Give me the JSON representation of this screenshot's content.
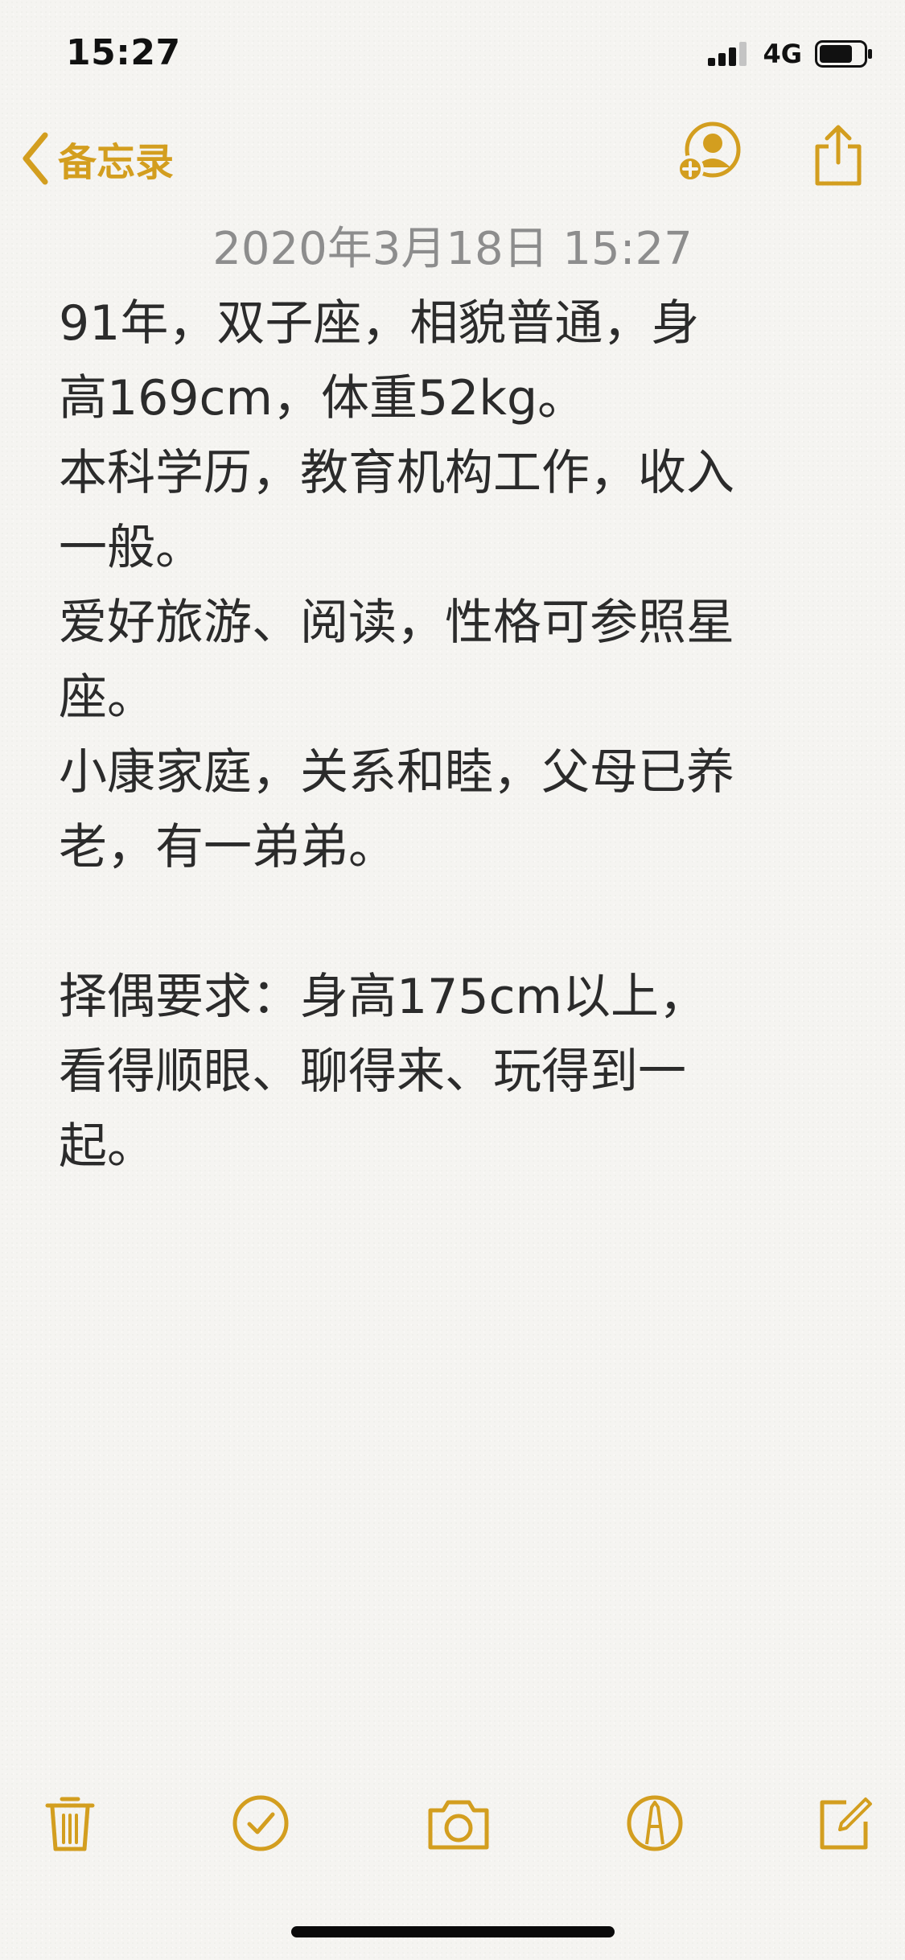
{
  "status_bar": {
    "time": "15:27",
    "network": "4G",
    "icons": [
      "signal-bars-icon",
      "battery-icon"
    ]
  },
  "nav": {
    "back_label": "备忘录",
    "icons": [
      "chevron-left-icon",
      "add-person-icon",
      "share-icon"
    ]
  },
  "note": {
    "date": "2020年3月18日 15:27",
    "lines": [
      "91年，双子座，相貌普通，身",
      "高169cm，体重52kg。",
      "本科学历，教育机构工作，收入",
      "一般。",
      "爱好旅游、阅读，性格可参照星",
      "座。",
      "小康家庭，关系和睦，父母已养",
      "老，有一弟弟。",
      "",
      "择偶要求：身高175cm以上，",
      "看得顺眼、聊得来、玩得到一",
      "起。"
    ]
  },
  "toolbar": {
    "icons": [
      "trash-icon",
      "checklist-icon",
      "camera-icon",
      "markup-icon",
      "compose-icon"
    ]
  },
  "colors": {
    "accent": "#d39e1f",
    "text": "#2b2b2b",
    "date": "#8d8d8d",
    "background": "#f5f4f1"
  }
}
